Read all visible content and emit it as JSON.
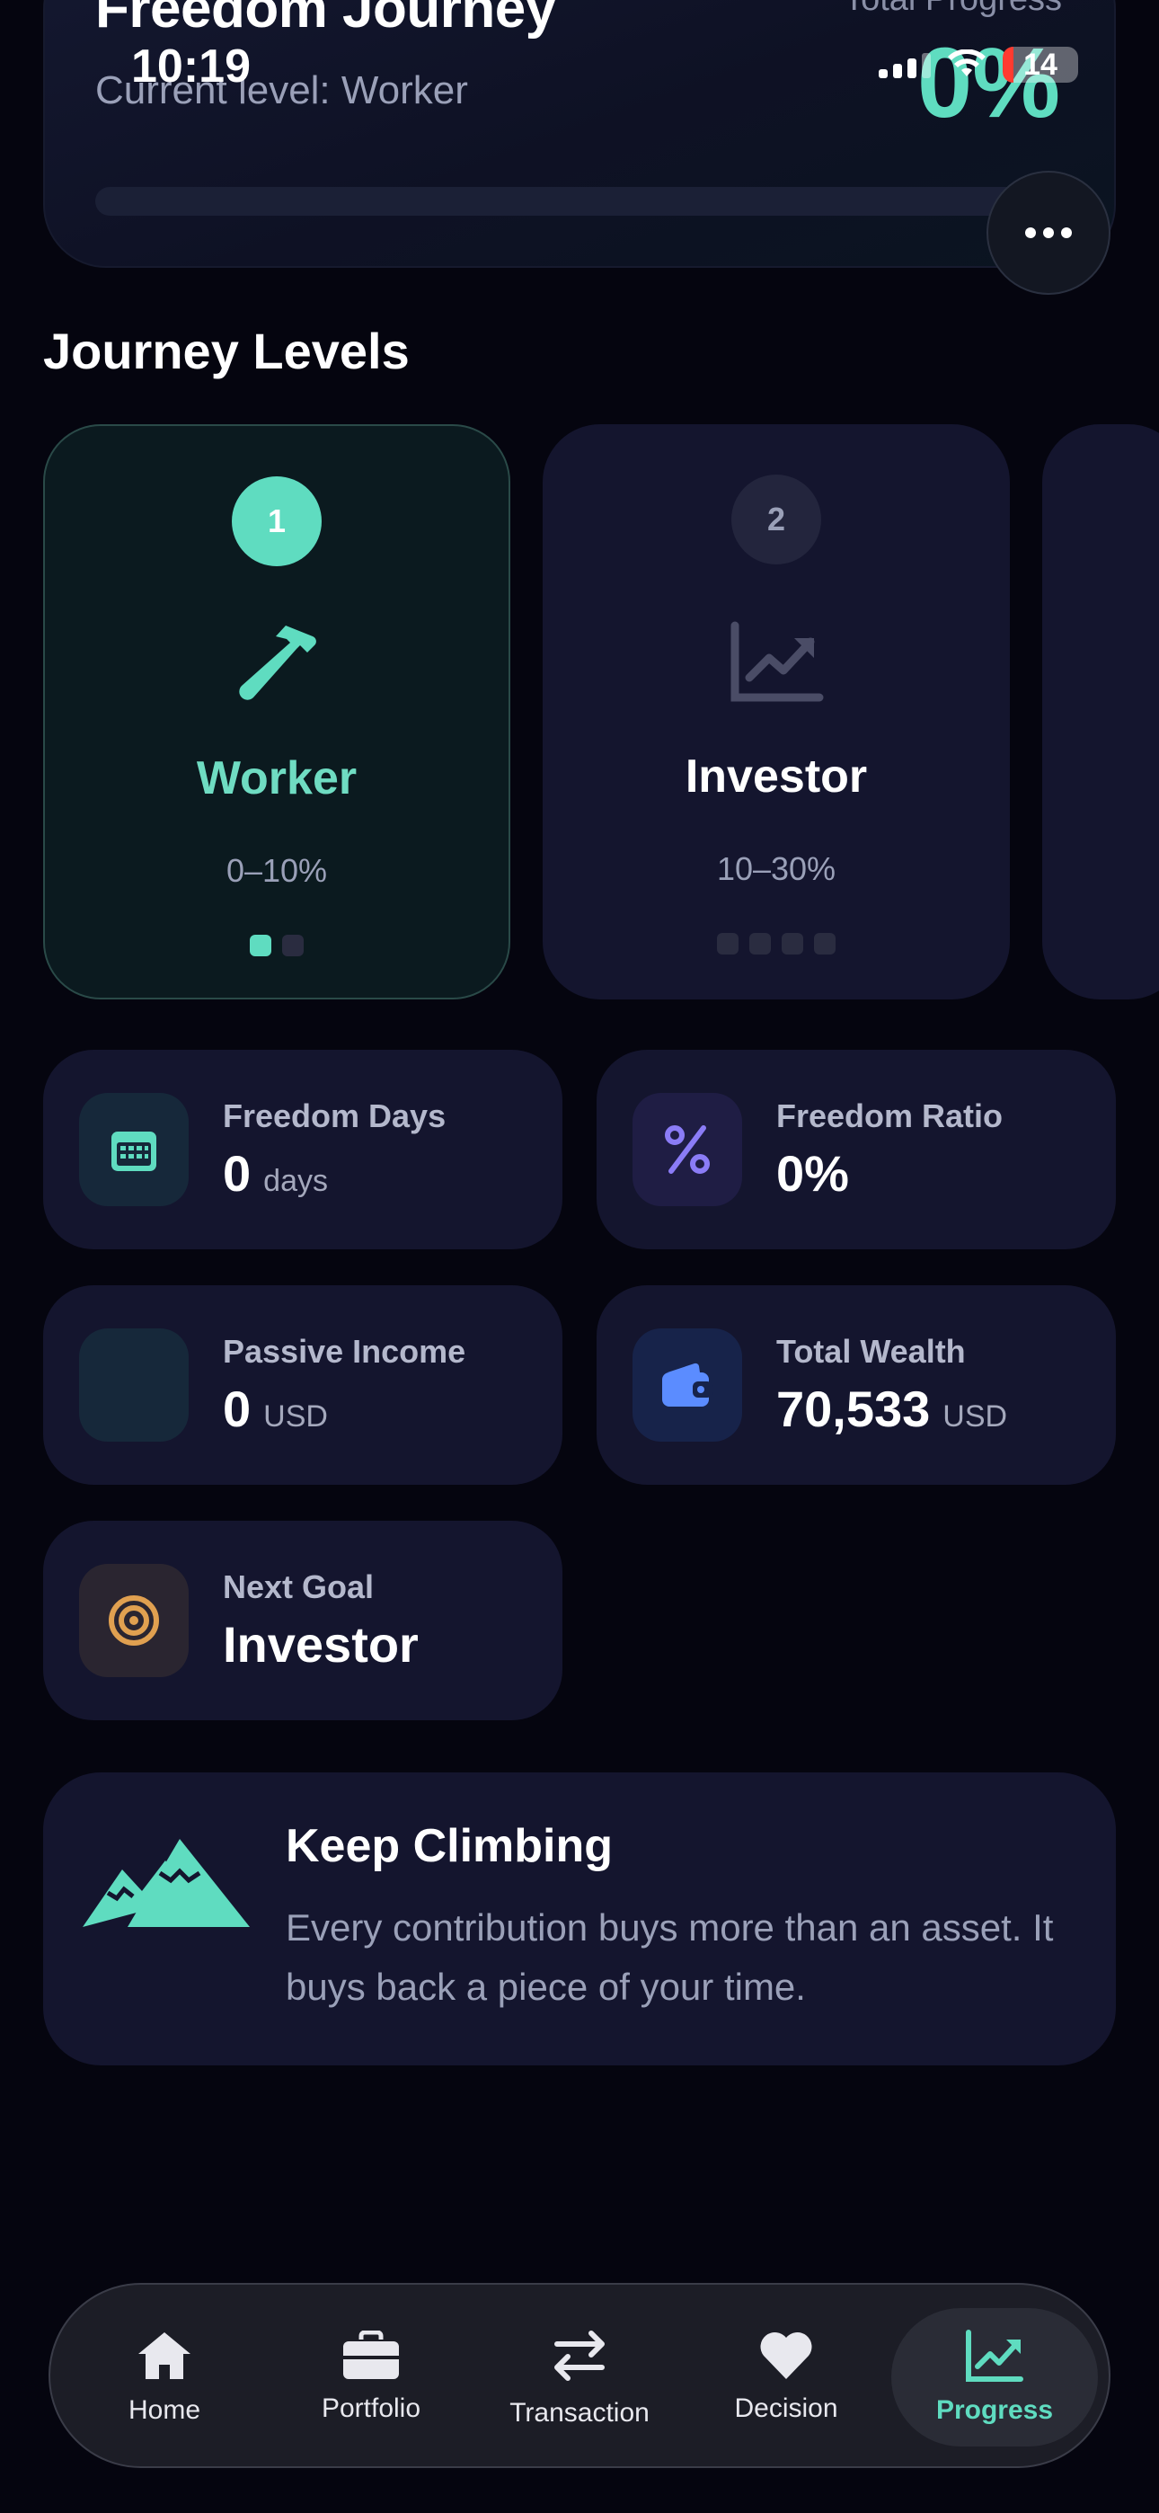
{
  "status_bar": {
    "time": "10:19",
    "battery": "14"
  },
  "header": {
    "title": "Freedom Journey",
    "subtitle": "Current level: Worker",
    "progress_label": "Total Progress",
    "progress_value": "0%",
    "progress_fraction": 0
  },
  "section": {
    "title": "Journey Levels"
  },
  "levels": [
    {
      "number": "1",
      "name": "Worker",
      "range": "0–10%",
      "icon": "hammer-icon",
      "active": true
    },
    {
      "number": "2",
      "name": "Investor",
      "range": "10–30%",
      "icon": "chart-line-icon",
      "active": false
    }
  ],
  "stats": {
    "freedom_days": {
      "label": "Freedom Days",
      "value": "0",
      "unit": "days",
      "icon": "calendar-icon",
      "color": "#5fdcc0"
    },
    "freedom_ratio": {
      "label": "Freedom Ratio",
      "value": "0%",
      "icon": "percent-icon",
      "color": "#8b7cf6"
    },
    "passive_income": {
      "label": "Passive Income",
      "value": "0",
      "unit": "USD",
      "icon": "income-icon",
      "color": "#5fdcc0"
    },
    "total_wealth": {
      "label": "Total Wealth",
      "value": "70,533",
      "unit": "USD",
      "icon": "wallet-icon",
      "color": "#5b8cff"
    },
    "next_goal": {
      "label": "Next Goal",
      "value": "Investor",
      "icon": "target-icon",
      "color": "#e0a050"
    }
  },
  "motivation": {
    "title": "Keep Climbing",
    "body": "Every contribution buys more than an asset. It buys back a piece of your time.",
    "icon": "mountains-icon"
  },
  "nav": [
    {
      "label": "Home",
      "icon": "home-icon"
    },
    {
      "label": "Portfolio",
      "icon": "briefcase-icon"
    },
    {
      "label": "Transaction",
      "icon": "transfer-icon"
    },
    {
      "label": "Decision",
      "icon": "heart-icon"
    },
    {
      "label": "Progress",
      "icon": "chart-line-icon",
      "active": true
    }
  ]
}
